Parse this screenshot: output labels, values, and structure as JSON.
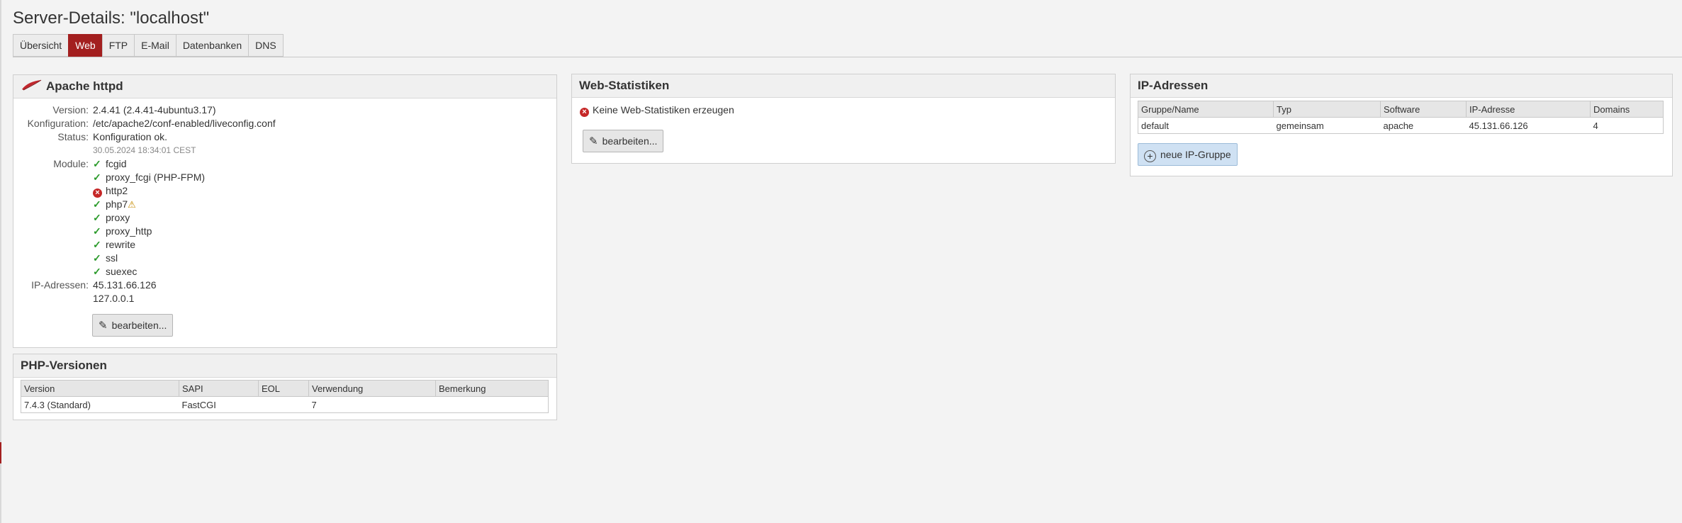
{
  "page": {
    "title": "Server-Details: \"localhost\""
  },
  "tabs": [
    {
      "label": "Übersicht",
      "active": false
    },
    {
      "label": "Web",
      "active": true
    },
    {
      "label": "FTP",
      "active": false
    },
    {
      "label": "E-Mail",
      "active": false
    },
    {
      "label": "Datenbanken",
      "active": false
    },
    {
      "label": "DNS",
      "active": false
    }
  ],
  "apache": {
    "title": "Apache httpd",
    "version_label": "Version:",
    "version": "2.4.41 (2.4.41-4ubuntu3.17)",
    "config_label": "Konfiguration:",
    "config": "/etc/apache2/conf-enabled/liveconfig.conf",
    "status_label": "Status:",
    "status": "Konfiguration ok.",
    "status_time": "30.05.2024 18:34:01 CEST",
    "modules_label": "Module:",
    "modules": [
      {
        "name": "fcgid",
        "state": "ok"
      },
      {
        "name": "proxy_fcgi (PHP-FPM)",
        "state": "ok"
      },
      {
        "name": "http2",
        "state": "error"
      },
      {
        "name": "php7",
        "state": "warning"
      },
      {
        "name": "proxy",
        "state": "ok"
      },
      {
        "name": "proxy_http",
        "state": "ok"
      },
      {
        "name": "rewrite",
        "state": "ok"
      },
      {
        "name": "ssl",
        "state": "ok"
      },
      {
        "name": "suexec",
        "state": "ok"
      }
    ],
    "ip_label": "IP-Adressen:",
    "ips": [
      "45.131.66.126",
      "127.0.0.1"
    ],
    "edit_label": "bearbeiten..."
  },
  "php": {
    "title": "PHP-Versionen",
    "columns": [
      "Version",
      "SAPI",
      "EOL",
      "Verwendung",
      "Bemerkung"
    ],
    "rows": [
      [
        "7.4.3 (Standard)",
        "FastCGI",
        "",
        "7",
        ""
      ]
    ]
  },
  "webstats": {
    "title": "Web-Statistiken",
    "message": "Keine Web-Statistiken erzeugen",
    "edit_label": "bearbeiten..."
  },
  "ipaddr": {
    "title": "IP-Adressen",
    "columns": [
      "Gruppe/Name",
      "Typ",
      "Software",
      "IP-Adresse",
      "Domains"
    ],
    "rows": [
      [
        "default",
        "gemeinsam",
        "apache",
        "45.131.66.126",
        "4"
      ]
    ],
    "add_label": "neue IP-Gruppe"
  },
  "colors": {
    "accent": "#a31f1f",
    "ok": "#2a9a2a",
    "error": "#c62828",
    "warning": "#c58a00"
  }
}
